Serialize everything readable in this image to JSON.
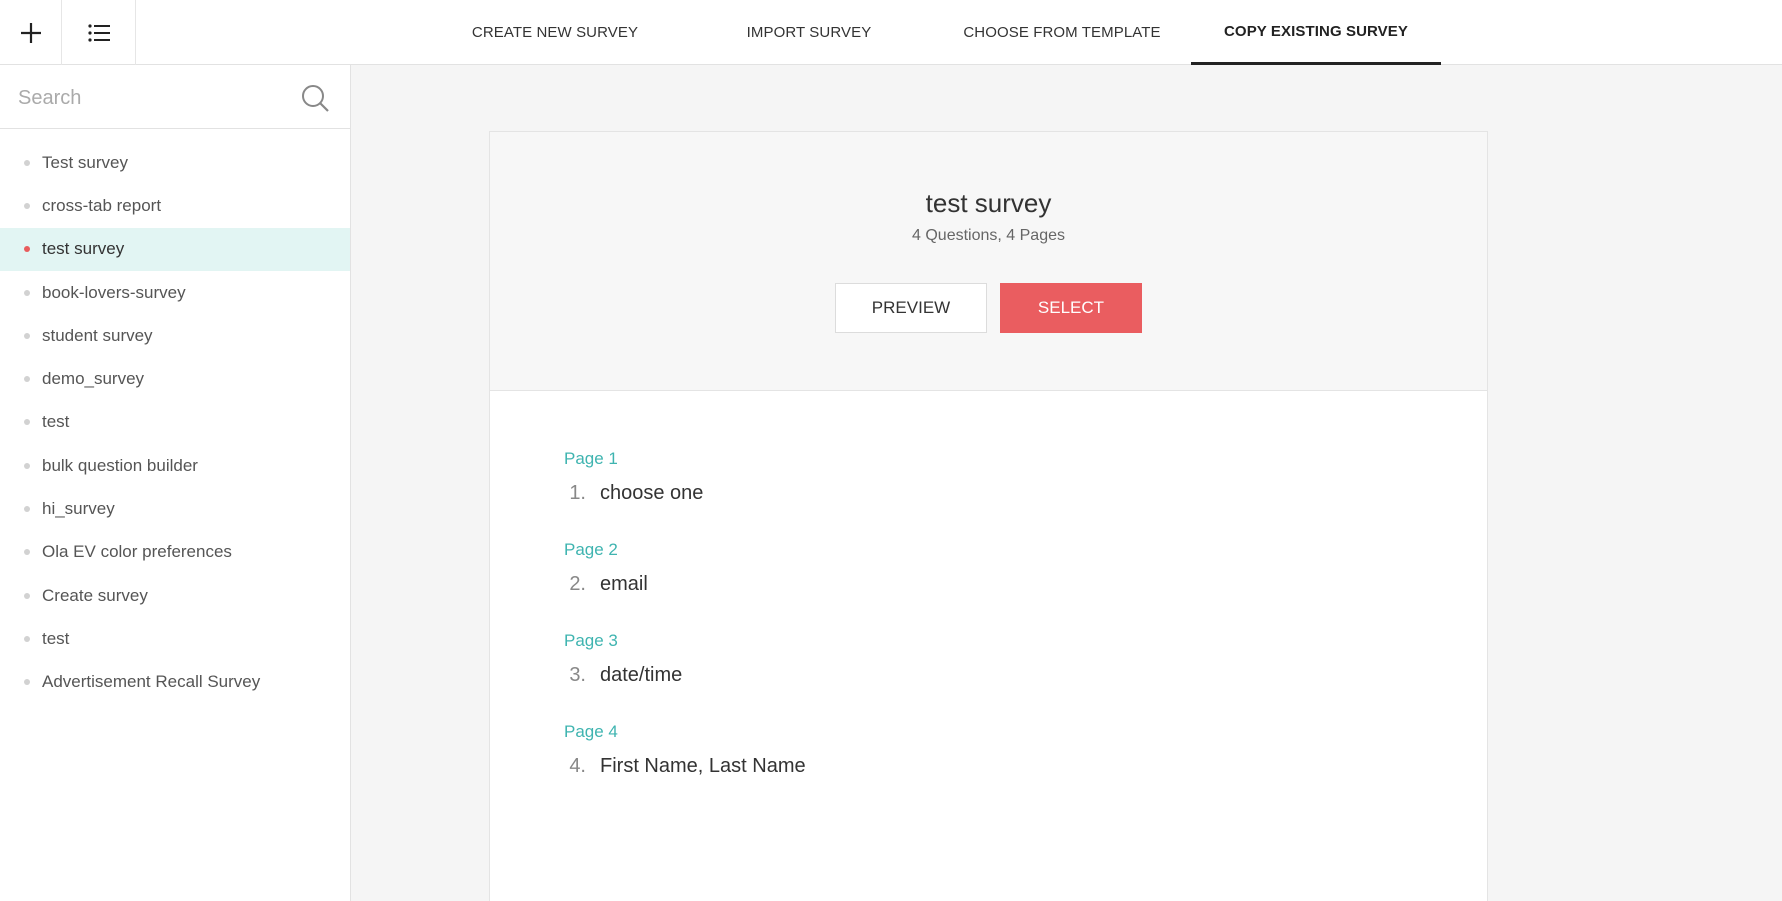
{
  "toolbar": {
    "tabs": [
      {
        "label": "CREATE NEW SURVEY",
        "active": false
      },
      {
        "label": "IMPORT SURVEY",
        "active": false
      },
      {
        "label": "CHOOSE FROM TEMPLATE",
        "active": false
      },
      {
        "label": "COPY EXISTING SURVEY",
        "active": true
      }
    ]
  },
  "sidebar": {
    "search_placeholder": "Search",
    "items": [
      {
        "label": "Test survey",
        "selected": false
      },
      {
        "label": "cross-tab report",
        "selected": false
      },
      {
        "label": "test survey",
        "selected": true
      },
      {
        "label": "book-lovers-survey",
        "selected": false
      },
      {
        "label": "student survey",
        "selected": false
      },
      {
        "label": "demo_survey",
        "selected": false
      },
      {
        "label": "test",
        "selected": false
      },
      {
        "label": "bulk question builder",
        "selected": false
      },
      {
        "label": "hi_survey",
        "selected": false
      },
      {
        "label": "Ola EV color preferences",
        "selected": false
      },
      {
        "label": "Create survey",
        "selected": false
      },
      {
        "label": "test",
        "selected": false
      },
      {
        "label": "Advertisement Recall Survey",
        "selected": false
      }
    ]
  },
  "preview": {
    "title": "test survey",
    "meta": "4 Questions, 4 Pages",
    "preview_label": "PREVIEW",
    "select_label": "SELECT",
    "pages": [
      {
        "label": "Page 1",
        "number": "1.",
        "question": "choose one"
      },
      {
        "label": "Page 2",
        "number": "2.",
        "question": "email"
      },
      {
        "label": "Page 3",
        "number": "3.",
        "question": "date/time"
      },
      {
        "label": "Page 4",
        "number": "4.",
        "question": "First Name, Last Name"
      }
    ]
  },
  "colors": {
    "accent": "#ea5d60",
    "page_label": "#3fb4b0",
    "selected_bg": "#e2f5f3"
  }
}
